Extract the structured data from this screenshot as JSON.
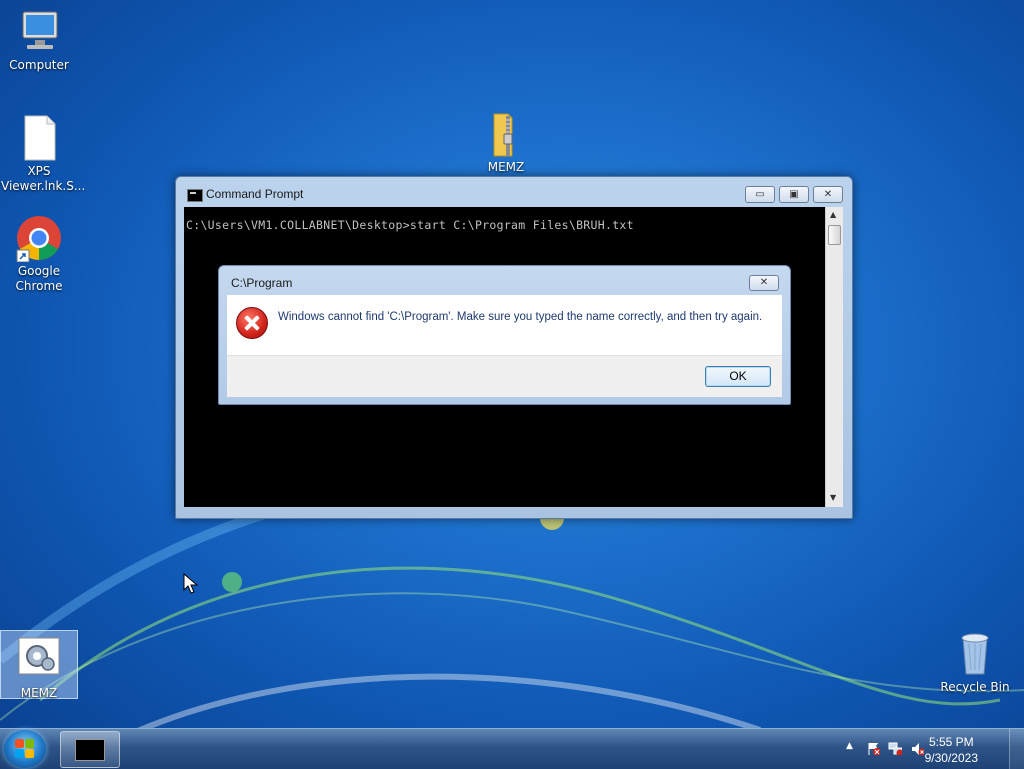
{
  "desktop": {
    "icons": [
      {
        "label": "Computer",
        "icon": "computer-icon"
      },
      {
        "label": "XPS Viewer.lnk.S...",
        "icon": "file-icon"
      },
      {
        "label": "Google Chrome",
        "icon": "chrome-icon"
      },
      {
        "label": "MEMZ",
        "icon": "zip-folder-icon"
      },
      {
        "label": "MEMZ",
        "icon": "settings-app-icon"
      },
      {
        "label": "Recycle Bin",
        "icon": "recycle-bin-icon"
      }
    ]
  },
  "cmd_window": {
    "title": "Command Prompt",
    "minimize_label": "▭",
    "maximize_label": "▣",
    "close_label": "✕",
    "console_line": "C:\\Users\\VM1.COLLABNET\\Desktop>start C:\\Program Files\\BRUH.txt"
  },
  "dialog": {
    "title": "C:\\Program",
    "close_label": "✕",
    "message": "Windows cannot find 'C:\\Program'. Make sure you typed the name correctly, and then try again.",
    "ok_label": "OK",
    "icon": "error-icon"
  },
  "taskbar": {
    "clock_time": "5:55 PM",
    "clock_date": "9/30/2023",
    "tray_chevron": "▲"
  },
  "colors": {
    "console_bg": "#000000",
    "console_text": "#c0c0c0",
    "dialog_text": "#1e3a6e",
    "error_red": "#d1231a"
  }
}
